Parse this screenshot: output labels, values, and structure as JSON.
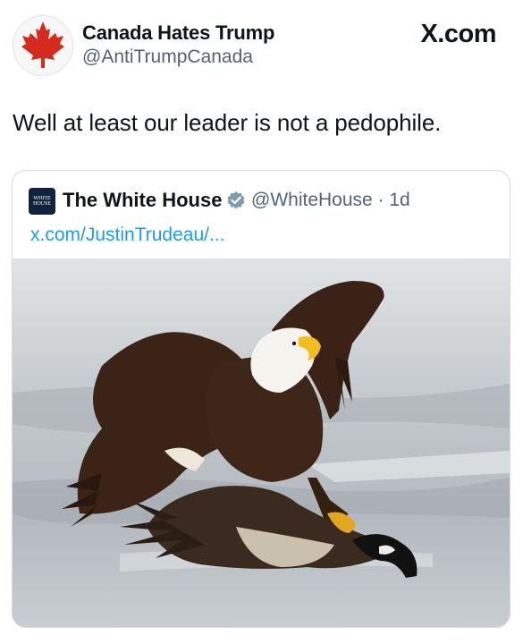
{
  "post": {
    "display_name": "Canada Hates Trump",
    "handle": "@AntiTrumpCanada",
    "brand": "X.com",
    "text": "Well at least our leader is not a pedophile."
  },
  "quote": {
    "avatar_text": "WHITE HOUSE",
    "display_name": "The White House",
    "handle_time": "@WhiteHouse · 1d",
    "link": "x.com/JustinTrudeau/..."
  },
  "icons": {
    "avatar": "maple-leaf-icon",
    "verified": "verified-badge-icon"
  },
  "colors": {
    "text": "#0f1419",
    "secondary": "#536471",
    "link": "#1d9bf0",
    "maple_red": "#d52b1e",
    "verified_gray": "#829aab"
  }
}
